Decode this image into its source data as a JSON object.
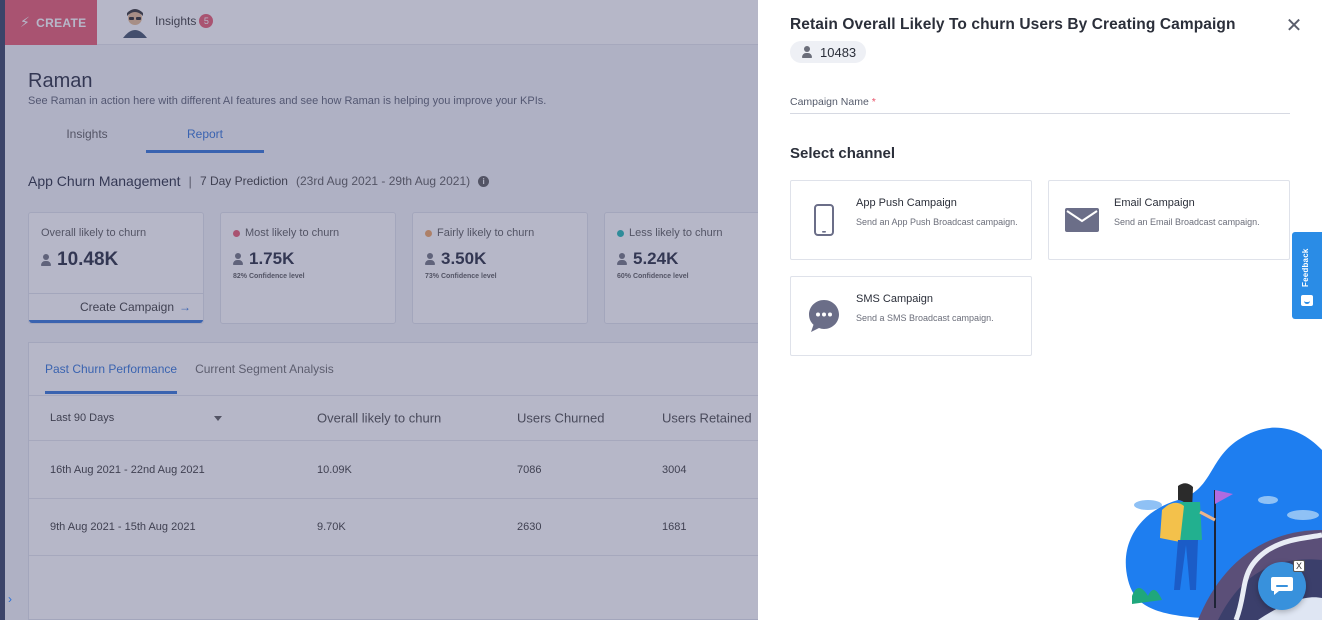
{
  "topbar": {
    "create_label": "CREATE",
    "insights_label": "Insights",
    "insights_badge": "5"
  },
  "page": {
    "title": "Raman",
    "subtitle": "See Raman in action here with different AI features and see how Raman is helping you improve your KPIs.",
    "tabs": [
      {
        "label": "Insights",
        "active": false
      },
      {
        "label": "Report",
        "active": true
      }
    ]
  },
  "section": {
    "title": "App Churn Management",
    "prediction": "7 Day Prediction",
    "range": "(23rd Aug 2021 - 29th Aug 2021)"
  },
  "cards": [
    {
      "label": "Overall likely to churn",
      "value": "10.48K",
      "action": "Create Campaign",
      "dot_color": ""
    },
    {
      "label": "Most likely to churn",
      "value": "1.75K",
      "confidence": "82% Confidence level",
      "dot_color": "#e8546a"
    },
    {
      "label": "Fairly likely to churn",
      "value": "3.50K",
      "confidence": "73% Confidence level",
      "dot_color": "#f0a15b"
    },
    {
      "label": "Less likely to churn",
      "value": "5.24K",
      "confidence": "60% Confidence level",
      "dot_color": "#17b5b0"
    }
  ],
  "performance": {
    "tabs": [
      "Past Churn Performance",
      "Current Segment Analysis"
    ],
    "period": "Last 90 Days",
    "columns": [
      "Overall likely to churn",
      "Users Churned",
      "Users Retained"
    ],
    "rows": [
      {
        "range": "16th Aug 2021 - 22nd Aug 2021",
        "overall": "10.09K",
        "churned": "7086",
        "retained": "3004"
      },
      {
        "range": "9th Aug 2021 - 15th Aug 2021",
        "overall": "9.70K",
        "churned": "2630",
        "retained": "1681"
      }
    ]
  },
  "drawer": {
    "title": "Retain Overall Likely To churn Users By Creating Campaign",
    "count": "10483",
    "campaign_name_label": "Campaign Name",
    "required_mark": "*",
    "campaign_name_value": "",
    "select_channel": "Select channel",
    "channels": [
      {
        "name": "App Push Campaign",
        "desc": "Send an App Push Broadcast campaign.",
        "icon": "mobile-icon"
      },
      {
        "name": "Email Campaign",
        "desc": "Send an Email Broadcast campaign.",
        "icon": "envelope-icon"
      },
      {
        "name": "SMS Campaign",
        "desc": "Send a SMS Broadcast campaign.",
        "icon": "chat-bubble-icon"
      }
    ],
    "icon_color": "#6b6e88"
  },
  "widgets": {
    "feedback_label": "Feedback",
    "chat_close": "X"
  },
  "colors": {
    "accent": "#2a6fd6",
    "create": "#e8546a",
    "feedback": "#2a8ce6"
  }
}
